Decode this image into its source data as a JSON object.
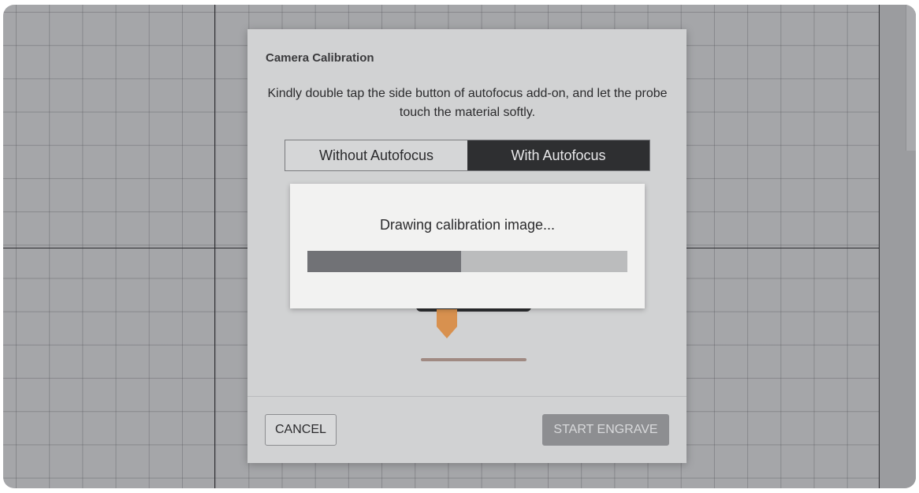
{
  "dialog": {
    "title": "Camera Calibration",
    "description": "Kindly double tap the side button of autofocus add-on, and let the probe touch the material softly.",
    "mode_toggle": {
      "options": [
        "Without Autofocus",
        "With Autofocus"
      ],
      "selected": "With Autofocus"
    },
    "cancel_label": "CANCEL",
    "start_label": "START ENGRAVE"
  },
  "progress": {
    "message": "Drawing calibration image...",
    "fraction": 0.48
  },
  "colors": {
    "probe": "#d8914f",
    "accent_dark": "#2e2f31"
  }
}
